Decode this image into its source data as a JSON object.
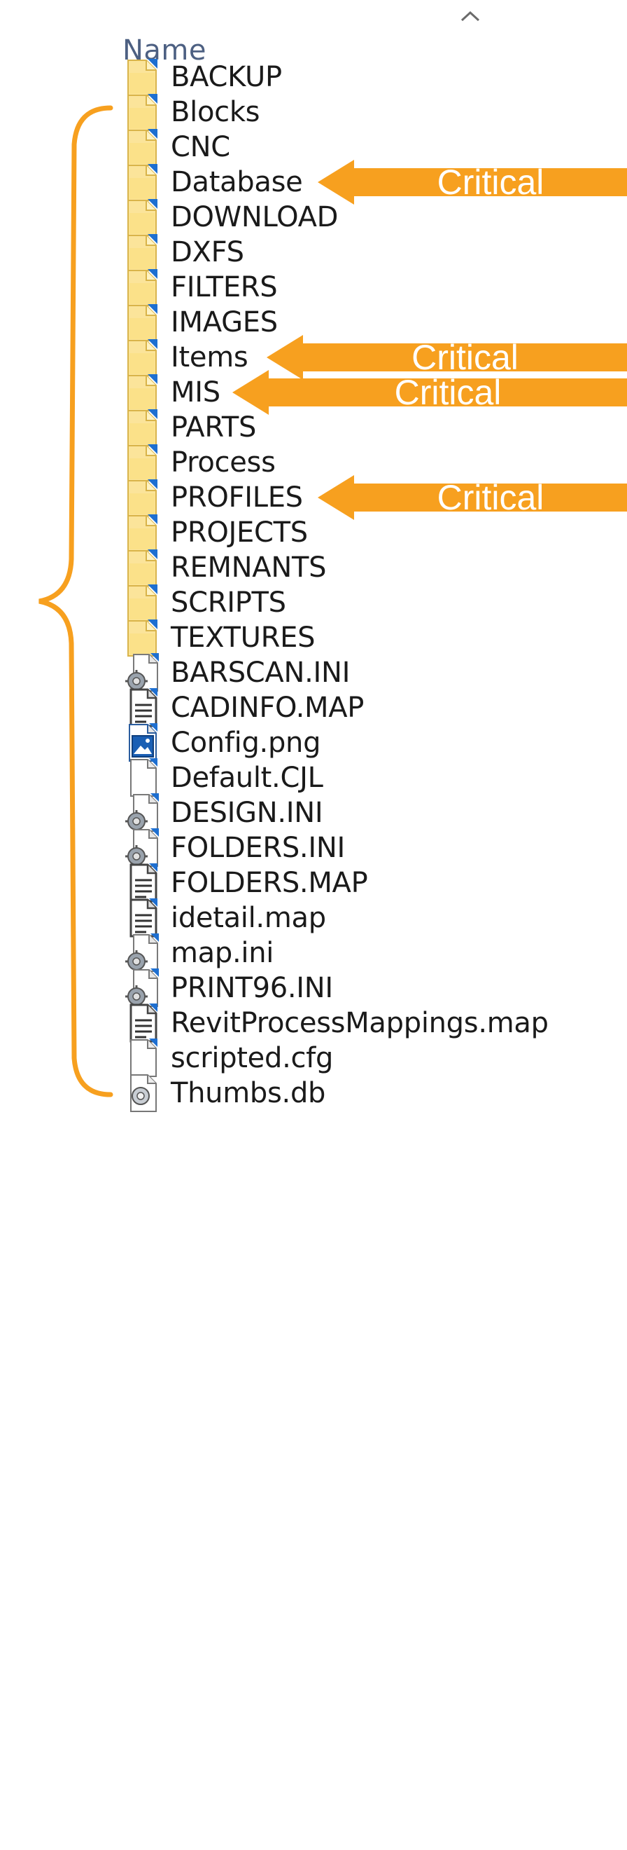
{
  "header": {
    "name_label": "Name",
    "sort_indicator": "chevron-up-icon"
  },
  "folders": [
    {
      "name": "BACKUP",
      "icon": "folder-icon"
    },
    {
      "name": "Blocks",
      "icon": "folder-icon"
    },
    {
      "name": "CNC",
      "icon": "folder-icon"
    },
    {
      "name": "Database",
      "icon": "folder-icon"
    },
    {
      "name": "DOWNLOAD",
      "icon": "folder-icon"
    },
    {
      "name": "DXFS",
      "icon": "folder-icon"
    },
    {
      "name": "FILTERS",
      "icon": "folder-icon"
    },
    {
      "name": "IMAGES",
      "icon": "folder-icon"
    },
    {
      "name": "Items",
      "icon": "folder-icon"
    },
    {
      "name": "MIS",
      "icon": "folder-icon"
    },
    {
      "name": "PARTS",
      "icon": "folder-icon"
    },
    {
      "name": "Process",
      "icon": "folder-icon"
    },
    {
      "name": "PROFILES",
      "icon": "folder-icon"
    },
    {
      "name": "PROJECTS",
      "icon": "folder-icon"
    },
    {
      "name": "REMNANTS",
      "icon": "folder-icon"
    },
    {
      "name": "SCRIPTS",
      "icon": "folder-icon"
    },
    {
      "name": "TEXTURES",
      "icon": "folder-icon"
    }
  ],
  "files": [
    {
      "name": "BARSCAN.INI",
      "icon": "config-settings-file-icon"
    },
    {
      "name": "CADINFO.MAP",
      "icon": "text-document-icon"
    },
    {
      "name": "Config.png",
      "icon": "image-file-icon"
    },
    {
      "name": "Default.CJL",
      "icon": "blank-file-icon"
    },
    {
      "name": "DESIGN.INI",
      "icon": "config-settings-file-icon"
    },
    {
      "name": "FOLDERS.INI",
      "icon": "config-settings-file-icon"
    },
    {
      "name": "FOLDERS.MAP",
      "icon": "text-document-icon"
    },
    {
      "name": "idetail.map",
      "icon": "text-document-icon"
    },
    {
      "name": "map.ini",
      "icon": "config-settings-file-icon"
    },
    {
      "name": "PRINT96.INI",
      "icon": "config-settings-file-icon"
    },
    {
      "name": "RevitProcessMappings.map",
      "icon": "text-document-icon"
    },
    {
      "name": "scripted.cfg",
      "icon": "blank-file-icon"
    },
    {
      "name": "Thumbs.db",
      "icon": "thumbs-db-icon"
    }
  ],
  "annotations": {
    "label": "Critical",
    "color": "#f7a01f",
    "brace_color": "#f7a01f",
    "critical_folders": [
      "Database",
      "Items",
      "MIS",
      "PROFILES"
    ]
  }
}
